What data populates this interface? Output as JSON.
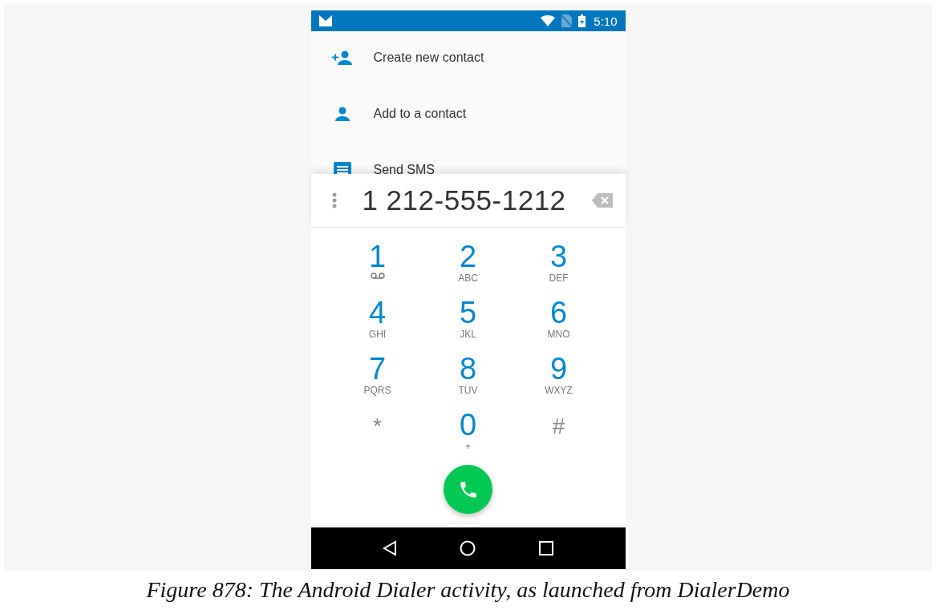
{
  "status_bar": {
    "time": "5:10"
  },
  "actions": [
    {
      "kind": "add-person",
      "label": "Create new contact"
    },
    {
      "kind": "person",
      "label": "Add to a contact"
    },
    {
      "kind": "message",
      "label": "Send SMS"
    }
  ],
  "dialed_number": "1 212-555-1212",
  "keypad": [
    {
      "kind": "voicemail",
      "main": "1"
    },
    {
      "kind": "digit",
      "main": "2",
      "letters": "ABC"
    },
    {
      "kind": "digit",
      "main": "3",
      "letters": "DEF"
    },
    {
      "kind": "digit",
      "main": "4",
      "letters": "GHI"
    },
    {
      "kind": "digit",
      "main": "5",
      "letters": "JKL"
    },
    {
      "kind": "digit",
      "main": "6",
      "letters": "MNO"
    },
    {
      "kind": "digit",
      "main": "7",
      "letters": "PQRS"
    },
    {
      "kind": "digit",
      "main": "8",
      "letters": "TUV"
    },
    {
      "kind": "digit",
      "main": "9",
      "letters": "WXYZ"
    },
    {
      "kind": "symbol",
      "main": "*"
    },
    {
      "kind": "digit",
      "main": "0",
      "letters": "+"
    },
    {
      "kind": "symbol",
      "main": "#"
    }
  ],
  "caption": "Figure 878: The Android Dialer activity, as launched from DialerDemo"
}
